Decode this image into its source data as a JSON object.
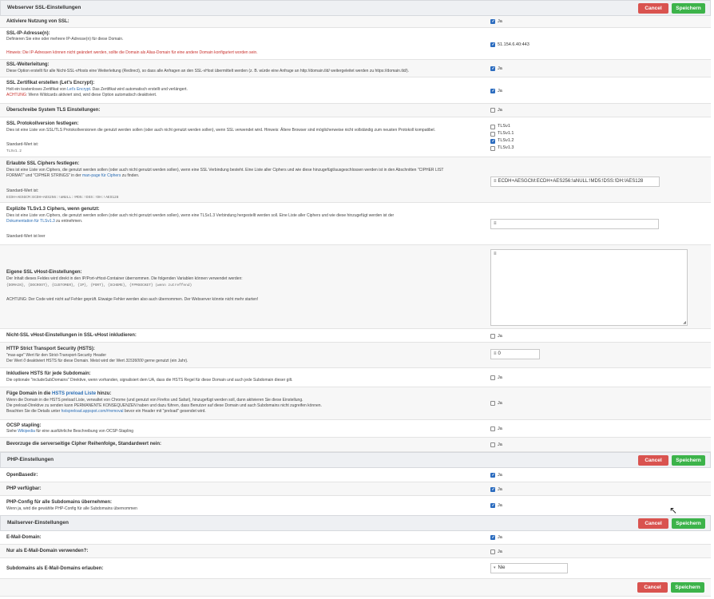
{
  "sections": {
    "ssl": {
      "title": "Webserver SSL-Einstellungen",
      "cancel": "Cancel",
      "save": "Speichern"
    },
    "php": {
      "title": "PHP-Einstellungen",
      "cancel": "Cancel",
      "save": "Speichern"
    },
    "mail": {
      "title": "Mailserver-Einstellungen",
      "cancel": "Cancel",
      "save": "Speichern"
    },
    "footer": {
      "cancel": "Cancel",
      "save": "Speichern"
    }
  },
  "ssl_rows": {
    "enable": {
      "label": "Aktiviere Nutzung von SSL:",
      "value": "Ja"
    },
    "ip": {
      "label": "SSL-IP-Adresse(n):",
      "desc": "Definieren Sie eine oder mehrere IP-Adresse(n) für diese Domain.",
      "hint": "Hinweis: Die IP-Adressen können nicht geändert werden, sollte die Domain als Alias-Domain für eine andere Domain konfiguriert worden sein.",
      "value": "51.154.6.40:443"
    },
    "redirect": {
      "label": "SSL-Weiterleitung:",
      "desc": "Diese Option erstellt für alle Nicht-SSL-vHosts eine Weiterleitung (Redirect), so dass alle Anfragen an den SSL-vHost übermittelt werden (z. B. würde eine Anfrage an http://domain.tld/ weitergeleitet werden zu https://domain.tld/).",
      "value": "Ja"
    },
    "letsencrypt": {
      "label": "SSL Zertifikat erstellen (Let's Encrypt):",
      "desc_a": "Holt ein kostenloses Zertifikat von ",
      "desc_link": "Let's Encrypt",
      "desc_b": ". Das Zertifikat wird automatisch erstellt und verlängert.",
      "warn_a": "ACHTUNG",
      "warn_b": ": Wenn Wildcards aktiviert sind, wird diese Option automatisch deaktiviert.",
      "value": "Ja"
    },
    "tls_override": {
      "label": "Überschreibe System TLS Einstellungen:",
      "value": "Ja"
    },
    "protocols": {
      "label": "SSL Protokollversion festlegen:",
      "desc": "Dies ist eine Liste von SSL/TLS Protokollversionen die genutzt werden sollen (oder auch nicht genutzt werden sollen), wenn SSL verwendet wird. Hinweis: Ältere Browser sind möglicherweise nicht vollständig zum neusten Protokoll kompatibel.",
      "default_label": "Standard-Wert ist:",
      "default_value": "TLSv1.2",
      "options": [
        "TLSv1",
        "TLSv1.1",
        "TLSv1.2",
        "TLSv1.3"
      ]
    },
    "ciphers": {
      "label": "Erlaubte SSL Ciphers festlegen:",
      "desc_1": "Dies ist eine Liste von Ciphers, die genutzt werden sollen (oder auch nicht genutzt werden sollen), wenn eine SSL Verbindung besteht. Eine Liste aller Ciphers und wie diese hinzugefügt/ausgeschlossen werden ist in den Abschnitten \"CIPHER LIST",
      "desc_2a": "FORMAT\" und \"CIPHER STRINGS\" in der ",
      "desc_2link": "man-page für Ciphers",
      "desc_2b": " zu finden.",
      "default_label": "Standard-Wert ist:",
      "default_value": "ECDH+AESGCM:ECDH+AES256:!aNULL:!MD5:!DSS:!DH:!AES128",
      "value": "ECDH+AESGCM:ECDH+AES256:!aNULL:!MD5:!DSS:!DH:!AES128"
    },
    "tls13": {
      "label": "Explizite TLSv1.3 Ciphers, wenn genutzt:",
      "desc_1": "Dies ist eine Liste von Ciphers, die genutzt werden sollen (oder auch nicht genutzt werden sollen), wenn eine TLSv1.3 Verbindung hergestellt werden soll. Eine Liste aller Ciphers und wie diese hinzugefügt werden ist der",
      "desc_link": "Dokumentation für TLSv1.3",
      "desc_2": " zu entnehmen.",
      "default": "Standard-Wert ist leer"
    },
    "vhost": {
      "label": "Eigene SSL vHost-Einstellungen:",
      "desc_1": "Der Inhalt dieses Feldes wird direkt in den IP/Port-vHost-Container übernommen. Die folgenden Variablen können verwendet werden:",
      "vars": "{DOMAIN}, {DOCROOT}, {CUSTOMER}, {IP}, {PORT}, {SCHEME}, {FPMSOCKET} (wenn zutreffend)",
      "warn": "ACHTUNG: Der Code wird nicht auf Fehler geprüft. Etwaige Fehler werden also auch übernommen. Der Webserver könnte nicht mehr starten!"
    },
    "nonssl_vhost": {
      "label": "Nicht-SSL vHost-Einstellungen in SSL-vHost inkludieren:",
      "value": "Ja"
    },
    "hsts": {
      "label": "HTTP Strict Transport Security (HSTS):",
      "desc_1": "\"max-age\" Wert für den Strict-Transport-Security Header",
      "desc_2a": "Der Wert ",
      "desc_2b": "0",
      "desc_2c": " deaktiviert HSTS für diese Domain. Meist wird der Wert ",
      "desc_2d": "31536000",
      "desc_2e": " gerne genutzt (ein Jahr).",
      "value": "0"
    },
    "hsts_sub": {
      "label": "Inkludiere HSTS für jede Subdomain:",
      "desc": "Die optionale \"includeSubDomains\" Direktive, wenn vorhanden, signalisiert dem UA, dass die HSTS Regel für diese Domain und auch jede Subdomain dieser gilt.",
      "value": "Ja"
    },
    "preload": {
      "label_a": "Füge Domain in die ",
      "label_link": "HSTS preload Liste",
      "label_b": " hinzu:",
      "desc_1": "Wenn die Domain in die HSTS preload Liste, verwaltet von Chrome (und genutzt von Firefox und Safari), hinzugefügt werden soll, dann aktivieren Sie diese Einstellung.",
      "desc_2": "Die preload-Direktive zu senden kann PERMANENTE KONSEQUENZEN haben und dazu führen, dass Benutzer auf diese Domain und auch Subdomains nicht zugreifen können.",
      "desc_3a": "Beachten Sie die Details unter ",
      "desc_3link": "hstspreload.appspot.com/#removal",
      "desc_3b": " bevor ein Header mit \"preload\" gesendet wird.",
      "value": "Ja"
    },
    "ocsp": {
      "label": "OCSP stapling:",
      "desc_a": "Siehe ",
      "desc_link": "Wikipedia",
      "desc_b": " für eine ausführliche Beschreibung von OCSP-Stapling",
      "value": "Ja"
    },
    "cipher_order": {
      "label": "Bevorzuge die serverseitige Cipher Reihenfolge, Standardwert nein:",
      "value": "Ja"
    }
  },
  "php_rows": {
    "openbasedir": {
      "label": "OpenBasedir:",
      "value": "Ja"
    },
    "available": {
      "label": "PHP verfügbar:",
      "value": "Ja"
    },
    "subdomains": {
      "label": "PHP-Config für alle Subdomains übernehmen:",
      "desc": "Wenn ja, wird die gewählte PHP-Config für alle Subdomains übernommen",
      "value": "Ja"
    }
  },
  "mail_rows": {
    "maildomain": {
      "label": "E-Mail-Domain:",
      "value": "Ja"
    },
    "only_mail": {
      "label": "Nur als E-Mail-Domain verwenden?:",
      "value": "Ja"
    },
    "sub_as_mail": {
      "label": "Subdomains als E-Mail-Domains erlauben:",
      "value": "Nie"
    }
  },
  "colors": {
    "cancel": "#d9534f",
    "save": "#3cb34a",
    "header": "#eef0f3",
    "link": "#2a6db5",
    "checkbox": "#2c6cbf"
  }
}
